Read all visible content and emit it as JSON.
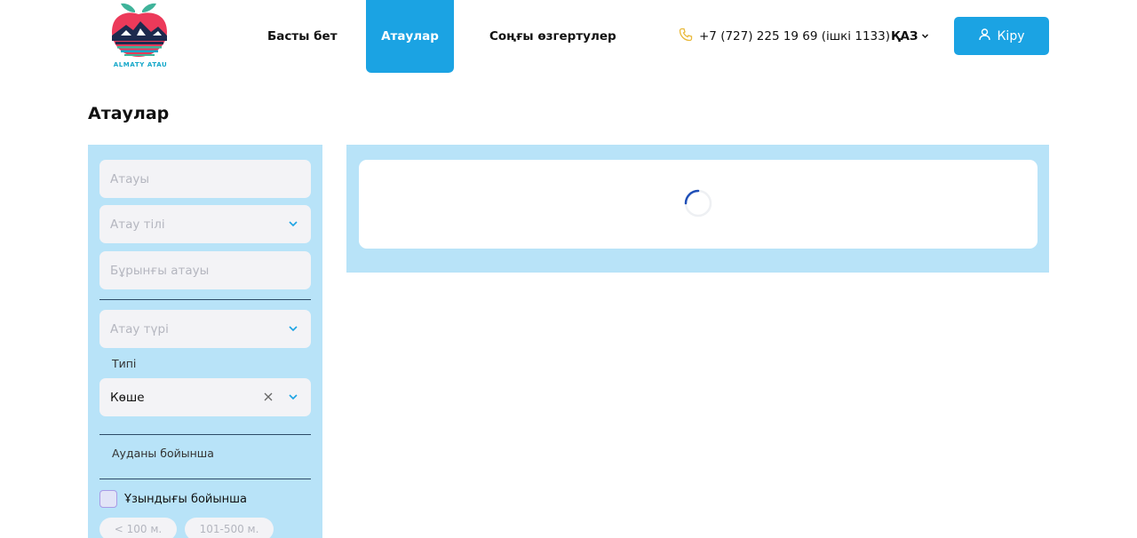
{
  "header": {
    "logo_text": "ALMATY ATAU",
    "nav": {
      "home": "Басты бет",
      "names": "Атаулар",
      "changes": "Соңғы өзгертулер"
    },
    "phone": "+7 (727) 225 19 69 (ішкі 1133)",
    "language": "ҚАЗ",
    "login": "Кіру"
  },
  "page": {
    "title": "Атаулар"
  },
  "filters": {
    "name_placeholder": "Атауы",
    "name_language_placeholder": "Атау тілі",
    "former_name_placeholder": "Бұрынғы атауы",
    "name_type_placeholder": "Атау түрі",
    "type_label": "Типі",
    "type_value": "Көше",
    "district_label": "Ауданы бойынша",
    "length_label": "Ұзындығы бойынша",
    "length_chips": [
      "< 100 м.",
      "101-500 м."
    ]
  },
  "colors": {
    "accent": "#1ba3e3",
    "panel": "#b8e3f8"
  }
}
